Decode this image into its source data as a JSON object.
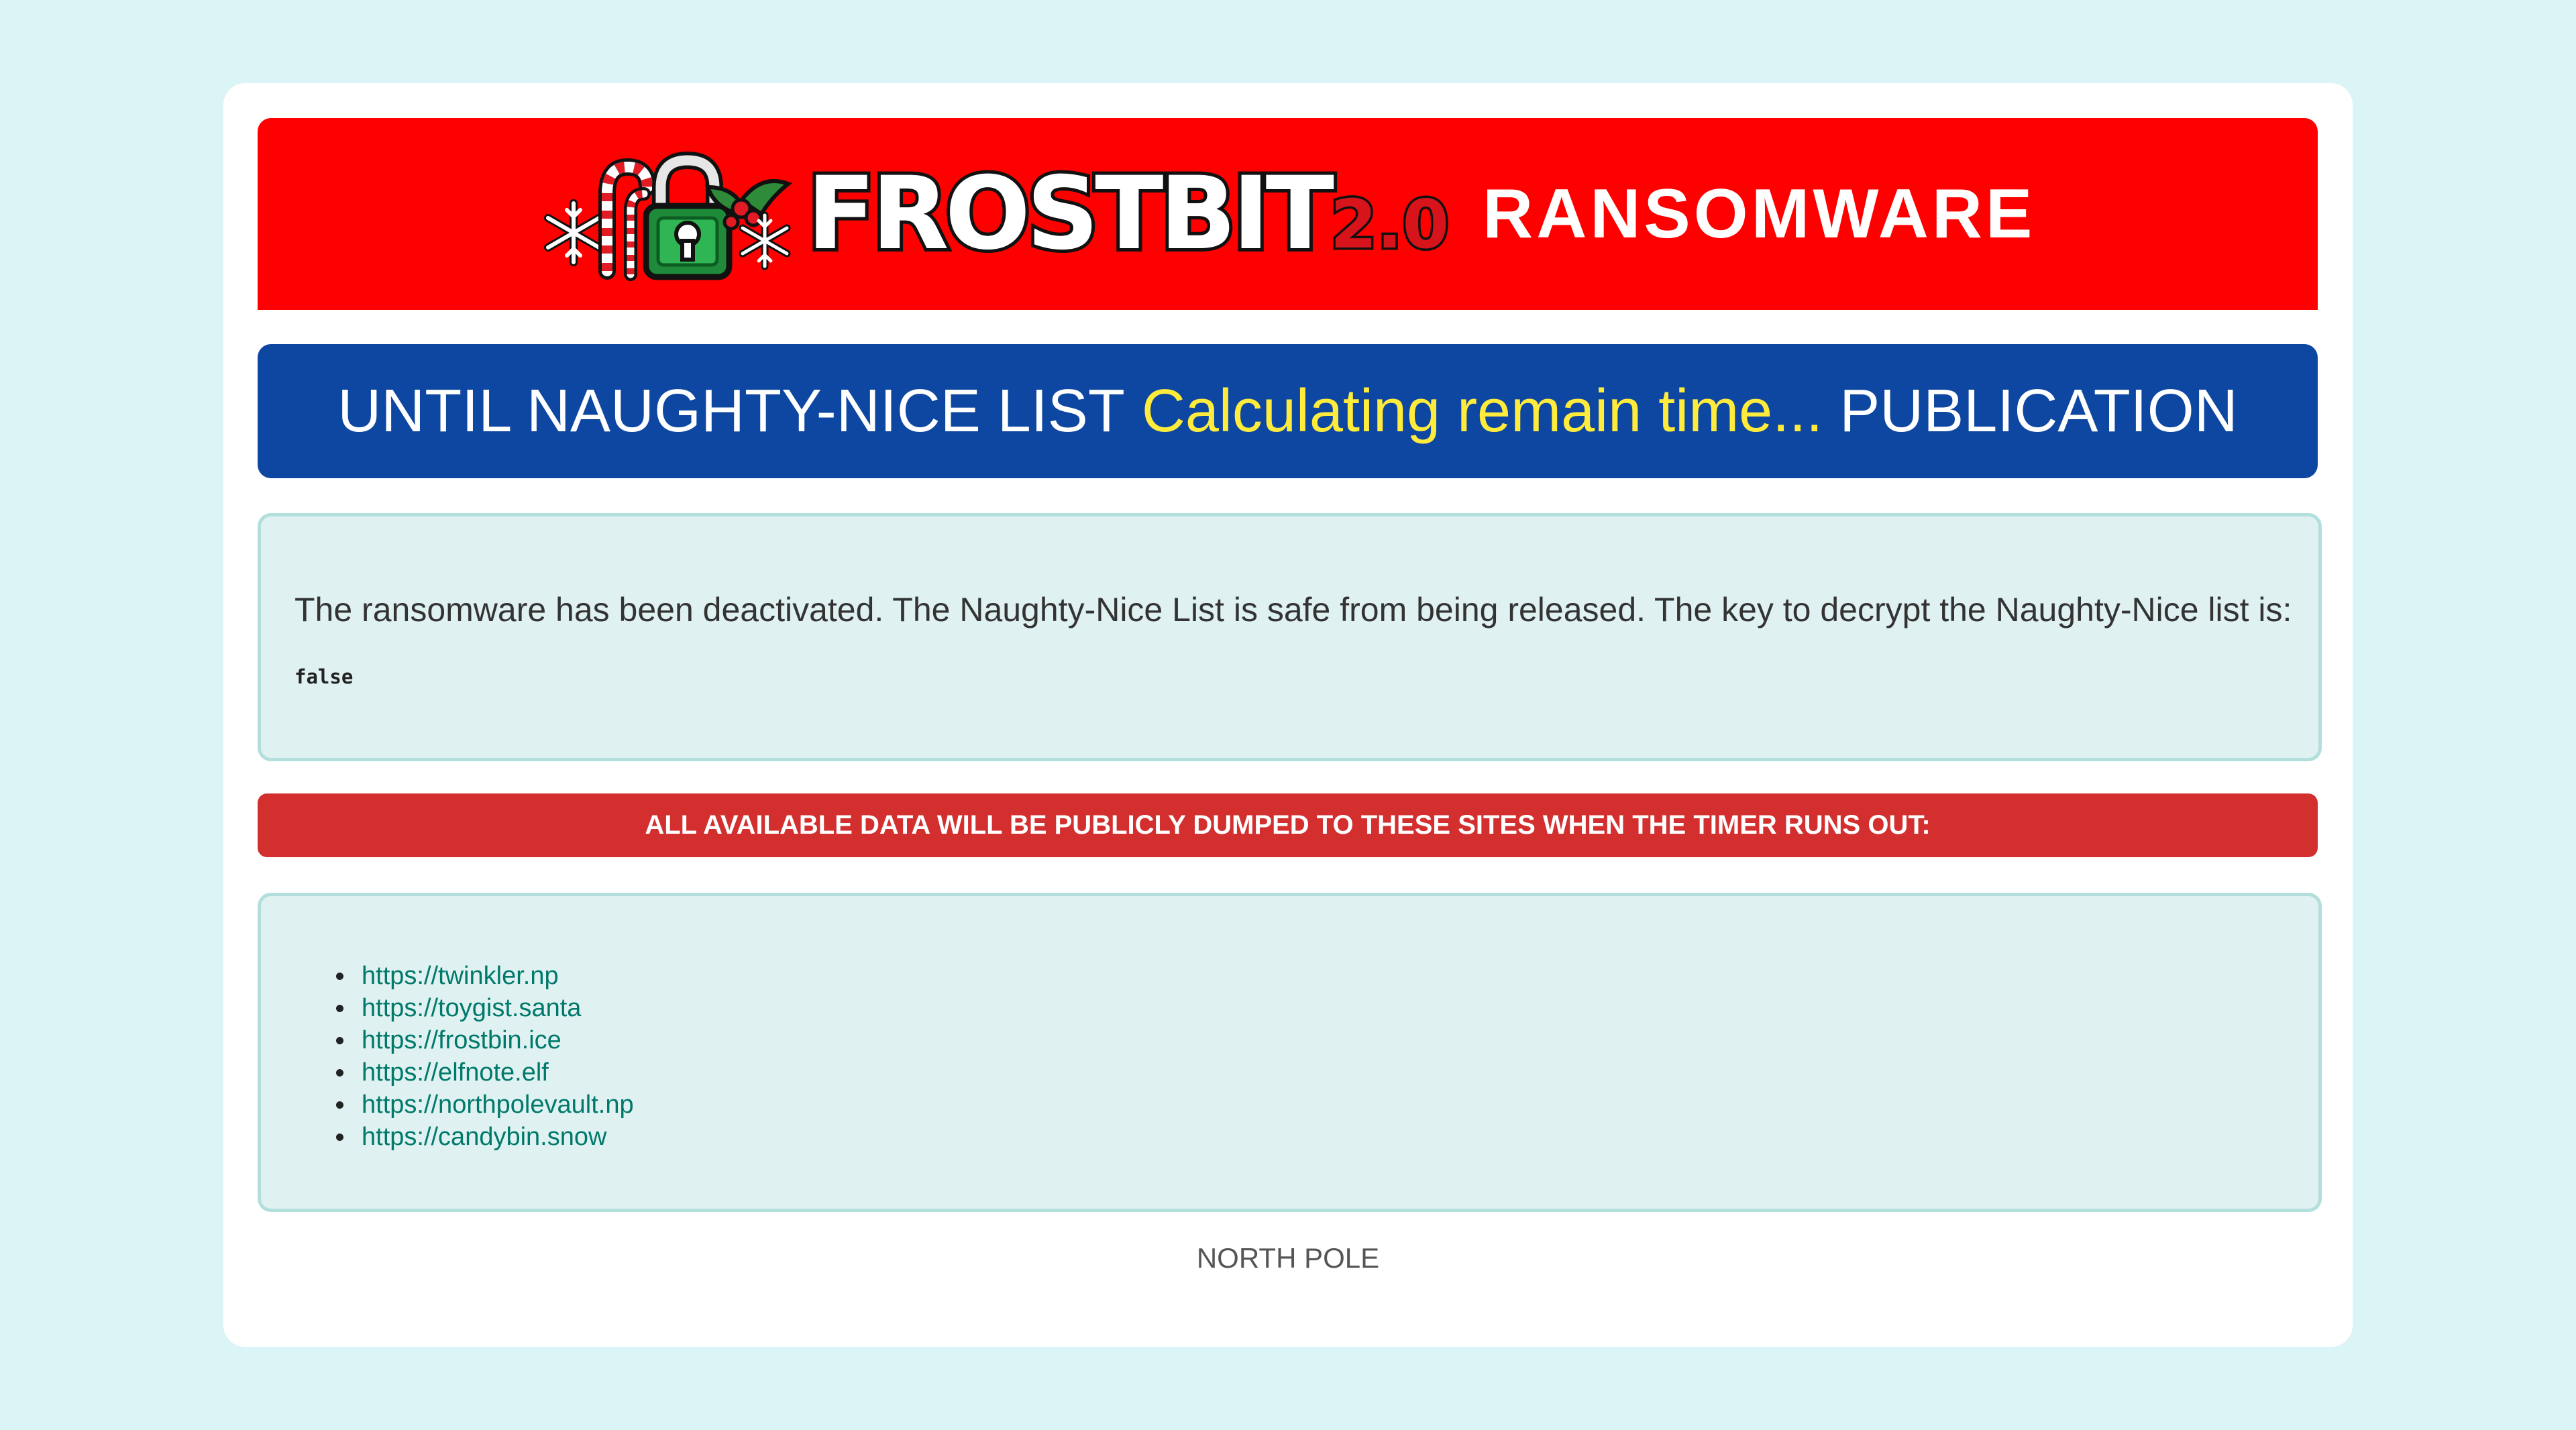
{
  "header": {
    "logo_word": "FROSTBIT",
    "logo_version": "2.0",
    "title": "RANSOMWARE"
  },
  "timer": {
    "prefix": "UNTIL NAUGHTY-NICE LIST",
    "countdown": "Calculating remain time...",
    "suffix": "PUBLICATION"
  },
  "message": {
    "text": "The ransomware has been deactivated. The Naughty-Nice List is safe from being released. The key to decrypt the Naughty-Nice list is:",
    "key": "false"
  },
  "warning": {
    "text": "ALL AVAILABLE DATA WILL BE PUBLICLY DUMPED TO THESE SITES WHEN THE TIMER RUNS OUT:"
  },
  "sites": [
    "https://twinkler.np",
    "https://toygist.santa",
    "https://frostbin.ice",
    "https://elfnote.elf",
    "https://northpolevault.np",
    "https://candybin.snow"
  ],
  "footer": {
    "text": "NORTH POLE"
  },
  "colors": {
    "page_background": "#dbf4f6",
    "banner": "#ff0000",
    "timer_background": "#0d47a1",
    "timer_highlight": "#ffeb3b",
    "warning_background": "#d32f2f",
    "panel_background": "#dff1f1",
    "link": "#00796b"
  },
  "icons": {
    "logo_decorations": [
      "snowflake-icon",
      "candy-cane-icon",
      "padlock-icon",
      "snowflake-icon",
      "holly-icon"
    ]
  }
}
